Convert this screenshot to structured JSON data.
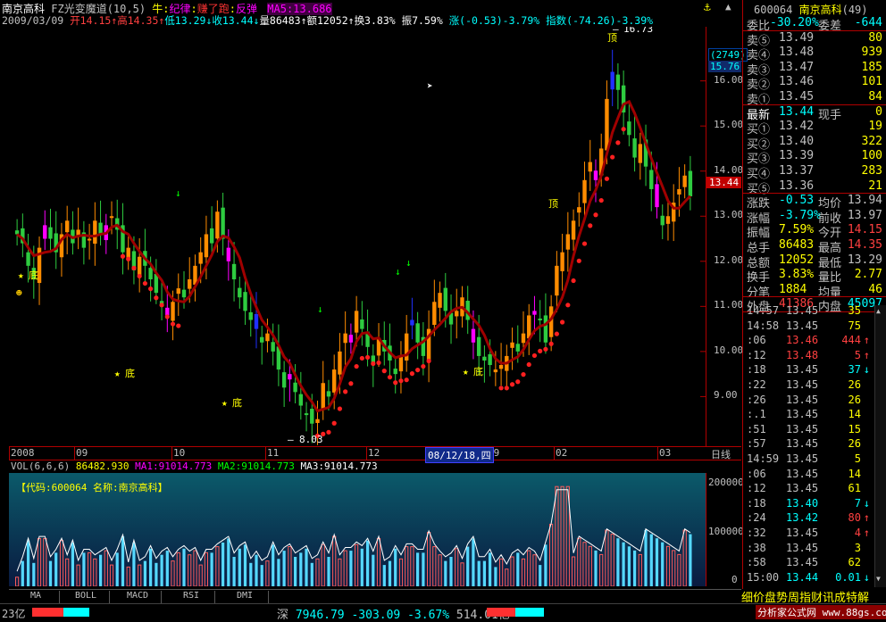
{
  "header": {
    "stock_name": "南京高科",
    "indicator": "FZ光变魔道(10,5)",
    "signals_prefix": "牛:",
    "sig1": "纪律",
    "sig2": "赚了跑",
    "sig3": "反弹",
    "ma5": "MA5:13.686"
  },
  "ohlc": {
    "date": "2009/03/09",
    "open": "开14.15",
    "high": "高14.35",
    "low": "低13.29",
    "close": "收13.44",
    "volume": "量86483",
    "amount": "额12052",
    "turnover": "换3.83%",
    "amplitude": "振7.59%",
    "change": "涨(-0.53)-3.79%",
    "index": "指数(-74.26)-3.39%"
  },
  "axis": {
    "prices": [
      "16.00",
      "15.00",
      "14.00",
      "13.00",
      "12.00",
      "11.00",
      "10.00",
      "9.00"
    ],
    "price_vals": [
      16,
      15,
      14,
      13,
      12,
      11,
      10,
      9
    ],
    "months": [
      "2008",
      "09",
      "10",
      "11",
      "12",
      "09",
      "02",
      "03"
    ],
    "date_box": "08/12/18,四",
    "period": "日线",
    "vol_ticks": [
      "200000",
      "100000",
      "0"
    ],
    "top_box1": "(2749)",
    "top_box2": "15.76",
    "cur_price": "13.44",
    "peak_label": "16.73",
    "low_label": "8.03",
    "bottom1": "底",
    "bottom2": "底",
    "bottom3": "底",
    "bottom4": "底",
    "top_mark1": "顶",
    "top_mark2": "顶"
  },
  "volume_bar": {
    "vol": "VOL(6,6,6)",
    "vol_val": "86482.930",
    "ma1": "MA1:91014.773",
    "ma2": "MA2:91014.773",
    "ma3": "MA3:91014.773",
    "code_label": "【代码:600064 名称:南京高科】"
  },
  "tabs": [
    "MA",
    "BOLL",
    "MACD",
    "RSI",
    "DMI"
  ],
  "quote_panel": {
    "code": "600064",
    "name": "南京高科",
    "count": "(49)",
    "weibi_label": "委比",
    "weibi_val": "-30.20%",
    "weicha_label": "委差",
    "weicha_val": "-644",
    "asks": [
      {
        "label": "卖⑤",
        "price": "13.49",
        "vol": "80"
      },
      {
        "label": "卖④",
        "price": "13.48",
        "vol": "939"
      },
      {
        "label": "卖③",
        "price": "13.47",
        "vol": "185"
      },
      {
        "label": "卖②",
        "price": "13.46",
        "vol": "101"
      },
      {
        "label": "卖①",
        "price": "13.45",
        "vol": "84"
      }
    ],
    "latest_label": "最新",
    "latest_val": "13.44",
    "xianshou_label": "现手",
    "xianshou_val": "0",
    "bids": [
      {
        "label": "买①",
        "price": "13.42",
        "vol": "19"
      },
      {
        "label": "买②",
        "price": "13.40",
        "vol": "322"
      },
      {
        "label": "买③",
        "price": "13.39",
        "vol": "100"
      },
      {
        "label": "买④",
        "price": "13.37",
        "vol": "283"
      },
      {
        "label": "买⑤",
        "price": "13.36",
        "vol": "21"
      }
    ],
    "stats": [
      {
        "l1": "涨跌",
        "v1": "-0.53",
        "l2": "均价",
        "v2": "13.94"
      },
      {
        "l1": "涨幅",
        "v1": "-3.79%",
        "l2": "前收",
        "v2": "13.97"
      },
      {
        "l1": "振幅",
        "v1": "7.59%",
        "l2": "今开",
        "v2": "14.15"
      },
      {
        "l1": "总手",
        "v1": "86483",
        "l2": "最高",
        "v2": "14.35"
      },
      {
        "l1": "总额",
        "v1": "12052",
        "l2": "最低",
        "v2": "13.29"
      },
      {
        "l1": "换手",
        "v1": "3.83%",
        "l2": "量比",
        "v2": "2.77"
      },
      {
        "l1": "分笔",
        "v1": "1884",
        "l2": "均量",
        "v2": "46"
      }
    ],
    "outer_label": "外盘",
    "outer_val": "41386",
    "inner_label": "内盘",
    "inner_val": "45097"
  },
  "ticks": [
    {
      "t": "14:57",
      "p": "13.45",
      "v": "35",
      "a": ""
    },
    {
      "t": "14:58",
      "p": "13.45",
      "v": "75",
      "a": ""
    },
    {
      "t": ":06",
      "p": "13.46",
      "v": "444",
      "a": "↑"
    },
    {
      "t": ":12",
      "p": "13.48",
      "v": "5",
      "a": "↑"
    },
    {
      "t": ":18",
      "p": "13.45",
      "v": "37",
      "a": "↓"
    },
    {
      "t": ":22",
      "p": "13.45",
      "v": "26",
      "a": ""
    },
    {
      "t": ":26",
      "p": "13.45",
      "v": "26",
      "a": ""
    },
    {
      "t": ":.1",
      "p": "13.45",
      "v": "14",
      "a": ""
    },
    {
      "t": ":51",
      "p": "13.45",
      "v": "15",
      "a": ""
    },
    {
      "t": ":57",
      "p": "13.45",
      "v": "26",
      "a": ""
    },
    {
      "t": "14:59",
      "p": "13.45",
      "v": "5",
      "a": ""
    },
    {
      "t": ":06",
      "p": "13.45",
      "v": "14",
      "a": ""
    },
    {
      "t": ":12",
      "p": "13.45",
      "v": "61",
      "a": ""
    },
    {
      "t": ":18",
      "p": "13.40",
      "v": "7",
      "a": "↓"
    },
    {
      "t": ":24",
      "p": "13.42",
      "v": "80",
      "a": "↑"
    },
    {
      "t": ":32",
      "p": "13.45",
      "v": "4",
      "a": "↑"
    },
    {
      "t": ":38",
      "p": "13.45",
      "v": "3",
      "a": ""
    },
    {
      "t": ":58",
      "p": "13.45",
      "v": "62",
      "a": ""
    },
    {
      "t": "15:00",
      "p": "13.44",
      "v": "0.01",
      "a": "↓"
    }
  ],
  "footer": {
    "left": "23亿",
    "index_name": "深",
    "index_val": "7946.79",
    "index_chg": "-303.09",
    "index_pct": "-3.67%",
    "index_amt": "514.01亿",
    "marquee": "细价盘势周指财讯成特解",
    "site": "分析家公式网 www.88gs.com"
  },
  "chart_data": {
    "type": "candlestick",
    "ylim": [
      7.9,
      17.2
    ],
    "closes": [
      12.6,
      12.4,
      11.9,
      11.6,
      12.3,
      12.8,
      12.5,
      12.2,
      12.6,
      12.9,
      12.4,
      12.7,
      12.3,
      12.5,
      12.9,
      12.6,
      12.8,
      13.0,
      12.7,
      12.2,
      12.3,
      11.8,
      12.1,
      11.9,
      11.6,
      11.3,
      11.0,
      10.8,
      11.1,
      11.4,
      11.2,
      11.6,
      11.9,
      12.2,
      12.6,
      12.4,
      13.1,
      12.5,
      12.0,
      11.6,
      11.2,
      10.9,
      10.7,
      10.5,
      10.2,
      10.4,
      10.0,
      9.6,
      9.2,
      9.5,
      9.1,
      8.8,
      8.6,
      8.4,
      8.5,
      9.3,
      9.0,
      9.6,
      10.0,
      10.4,
      10.2,
      10.9,
      10.5,
      10.1,
      9.7,
      10.3,
      10.0,
      9.8,
      9.5,
      9.9,
      10.4,
      10.7,
      10.2,
      9.9,
      10.5,
      11.1,
      11.3,
      10.9,
      10.6,
      10.9,
      11.2,
      10.7,
      10.2,
      9.9,
      9.8,
      9.7,
      9.6,
      9.7,
      9.9,
      10.2,
      10.0,
      10.4,
      10.8,
      10.9,
      10.7,
      10.2,
      11.0,
      11.9,
      12.2,
      12.6,
      12.9,
      13.2,
      13.8,
      14.2,
      13.8,
      14.5,
      15.6,
      16.2,
      15.8,
      15.3,
      14.8,
      14.3,
      14.6,
      14.1,
      13.6,
      13.2,
      12.8,
      13.0,
      13.3,
      13.6,
      13.9,
      13.44
    ],
    "vol_max": 250000
  }
}
